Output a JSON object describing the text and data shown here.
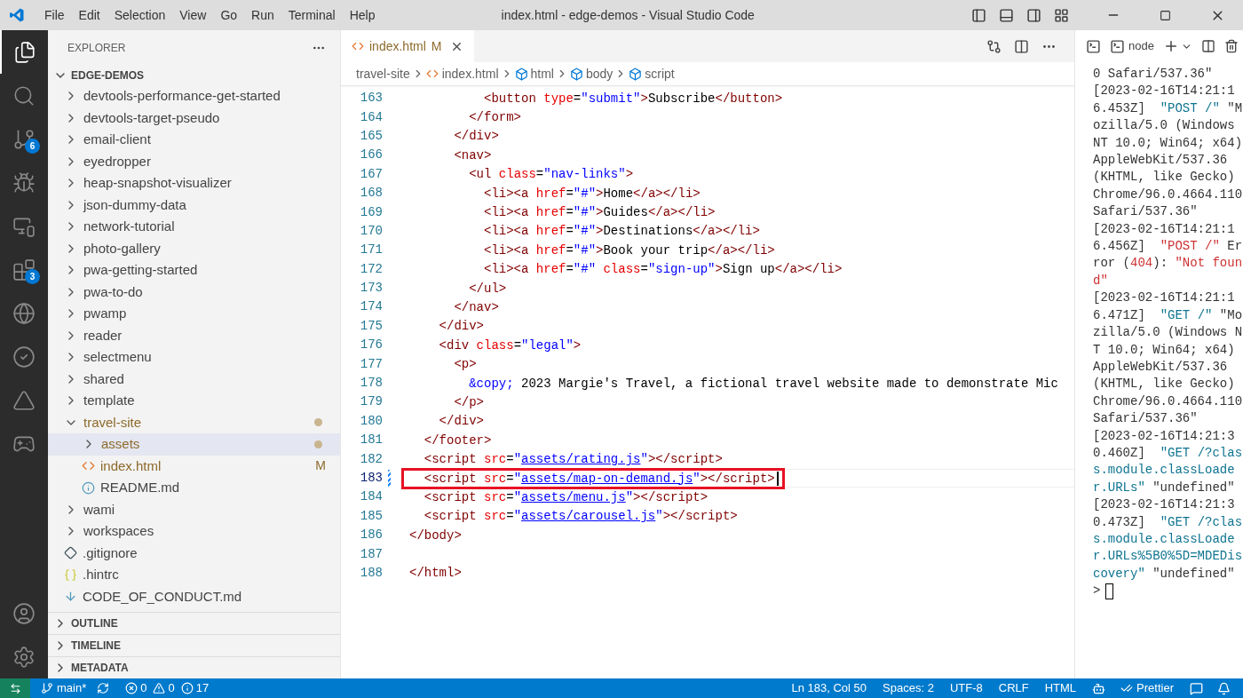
{
  "window": {
    "title": "index.html - edge-demos - Visual Studio Code",
    "menu": [
      "File",
      "Edit",
      "Selection",
      "View",
      "Go",
      "Run",
      "Terminal",
      "Help"
    ]
  },
  "activity_bar": [
    {
      "kind": "explorer",
      "selected": true
    },
    {
      "kind": "search",
      "selected": false
    },
    {
      "kind": "source-control",
      "selected": false,
      "badge": "6"
    },
    {
      "kind": "run",
      "selected": false
    },
    {
      "kind": "remote",
      "selected": false
    },
    {
      "kind": "extensions",
      "selected": false,
      "badge": "3"
    },
    {
      "kind": "edge",
      "selected": false
    },
    {
      "kind": "testing",
      "selected": false
    },
    {
      "kind": "azure",
      "selected": false
    },
    {
      "kind": "gamepad",
      "selected": false
    }
  ],
  "activity_bottom": [
    {
      "kind": "account"
    },
    {
      "kind": "settings"
    }
  ],
  "explorer": {
    "title": "EXPLORER",
    "root": {
      "label": "EDGE-DEMOS",
      "expanded": true,
      "children": [
        {
          "label": "devtools-performance-get-started",
          "kind": "folder",
          "expanded": false,
          "selected": false,
          "modified": false
        },
        {
          "label": "devtools-target-pseudo",
          "kind": "folder",
          "expanded": false,
          "selected": false,
          "modified": false
        },
        {
          "label": "email-client",
          "kind": "folder",
          "expanded": false,
          "selected": false,
          "modified": false
        },
        {
          "label": "eyedropper",
          "kind": "folder",
          "expanded": false,
          "selected": false,
          "modified": false
        },
        {
          "label": "heap-snapshot-visualizer",
          "kind": "folder",
          "expanded": false,
          "selected": false,
          "modified": false
        },
        {
          "label": "json-dummy-data",
          "kind": "folder",
          "expanded": false,
          "selected": false,
          "modified": false
        },
        {
          "label": "network-tutorial",
          "kind": "folder",
          "expanded": false,
          "selected": false,
          "modified": false
        },
        {
          "label": "photo-gallery",
          "kind": "folder",
          "expanded": false,
          "selected": false,
          "modified": false
        },
        {
          "label": "pwa-getting-started",
          "kind": "folder",
          "expanded": false,
          "selected": false,
          "modified": false
        },
        {
          "label": "pwa-to-do",
          "kind": "folder",
          "expanded": false,
          "selected": false,
          "modified": false
        },
        {
          "label": "pwamp",
          "kind": "folder",
          "expanded": false,
          "selected": false,
          "modified": false
        },
        {
          "label": "reader",
          "kind": "folder",
          "expanded": false,
          "selected": false,
          "modified": false
        },
        {
          "label": "selectmenu",
          "kind": "folder",
          "expanded": false,
          "selected": false,
          "modified": false
        },
        {
          "label": "shared",
          "kind": "folder",
          "expanded": false,
          "selected": false,
          "modified": false
        },
        {
          "label": "template",
          "kind": "folder",
          "expanded": false,
          "selected": false,
          "modified": false
        },
        {
          "label": "travel-site",
          "kind": "folder",
          "expanded": true,
          "selected": false,
          "modified": true,
          "children": [
            {
              "label": "assets",
              "kind": "folder",
              "expanded": false,
              "selected": true,
              "modified": true
            },
            {
              "label": "index.html",
              "kind": "html",
              "selected": false,
              "modified": true,
              "badge": "M"
            },
            {
              "label": "README.md",
              "kind": "info",
              "selected": false,
              "modified": false
            }
          ]
        },
        {
          "label": "wami",
          "kind": "folder",
          "expanded": false,
          "selected": false,
          "modified": false
        },
        {
          "label": "workspaces",
          "kind": "folder",
          "expanded": false,
          "selected": false,
          "modified": false
        },
        {
          "label": ".gitignore",
          "kind": "git",
          "selected": false,
          "modified": false
        },
        {
          "label": ".hintrc",
          "kind": "json",
          "selected": false,
          "modified": false
        },
        {
          "label": "CODE_OF_CONDUCT.md",
          "kind": "download",
          "selected": false,
          "modified": false
        }
      ]
    },
    "sections": [
      {
        "label": "OUTLINE",
        "expanded": false
      },
      {
        "label": "TIMELINE",
        "expanded": false
      },
      {
        "label": "METADATA",
        "expanded": false
      }
    ]
  },
  "editor": {
    "tabs": [
      {
        "label": "index.html",
        "badge": "M",
        "selected": true
      }
    ],
    "breadcrumb": [
      {
        "label": "travel-site",
        "kind": "folder"
      },
      {
        "label": "index.html",
        "kind": "html"
      },
      {
        "label": "html",
        "kind": "element"
      },
      {
        "label": "body",
        "kind": "element"
      },
      {
        "label": "script",
        "kind": "element"
      }
    ],
    "lines": [
      {
        "number": "163",
        "current": false,
        "annotated": false,
        "tokens": [
          {
            "kind": "tag",
            "text": "          <button"
          },
          {
            "kind": "attr",
            "text": " type"
          },
          {
            "kind": "text",
            "text": "="
          },
          {
            "kind": "str",
            "text": "\"submit\""
          },
          {
            "kind": "tag",
            "text": ">"
          },
          {
            "kind": "text",
            "text": "Subscribe"
          },
          {
            "kind": "tag",
            "text": "</button>"
          }
        ]
      },
      {
        "number": "164",
        "current": false,
        "annotated": false,
        "tokens": [
          {
            "kind": "tag",
            "text": "        </form>"
          }
        ]
      },
      {
        "number": "165",
        "current": false,
        "annotated": false,
        "tokens": [
          {
            "kind": "tag",
            "text": "      </div>"
          }
        ]
      },
      {
        "number": "166",
        "current": false,
        "annotated": false,
        "tokens": [
          {
            "kind": "tag",
            "text": "      <nav>"
          }
        ]
      },
      {
        "number": "167",
        "current": false,
        "annotated": false,
        "tokens": [
          {
            "kind": "tag",
            "text": "        <ul"
          },
          {
            "kind": "attr",
            "text": " class"
          },
          {
            "kind": "text",
            "text": "="
          },
          {
            "kind": "str",
            "text": "\"nav-links\""
          },
          {
            "kind": "tag",
            "text": ">"
          }
        ]
      },
      {
        "number": "168",
        "current": false,
        "annotated": false,
        "tokens": [
          {
            "kind": "tag",
            "text": "          <li><a"
          },
          {
            "kind": "attr",
            "text": " href"
          },
          {
            "kind": "text",
            "text": "="
          },
          {
            "kind": "str",
            "text": "\"#\""
          },
          {
            "kind": "tag",
            "text": ">"
          },
          {
            "kind": "text",
            "text": "Home"
          },
          {
            "kind": "tag",
            "text": "</a></li>"
          }
        ]
      },
      {
        "number": "169",
        "current": false,
        "annotated": false,
        "tokens": [
          {
            "kind": "tag",
            "text": "          <li><a"
          },
          {
            "kind": "attr",
            "text": " href"
          },
          {
            "kind": "text",
            "text": "="
          },
          {
            "kind": "str",
            "text": "\"#\""
          },
          {
            "kind": "tag",
            "text": ">"
          },
          {
            "kind": "text",
            "text": "Guides"
          },
          {
            "kind": "tag",
            "text": "</a></li>"
          }
        ]
      },
      {
        "number": "170",
        "current": false,
        "annotated": false,
        "tokens": [
          {
            "kind": "tag",
            "text": "          <li><a"
          },
          {
            "kind": "attr",
            "text": " href"
          },
          {
            "kind": "text",
            "text": "="
          },
          {
            "kind": "str",
            "text": "\"#\""
          },
          {
            "kind": "tag",
            "text": ">"
          },
          {
            "kind": "text",
            "text": "Destinations"
          },
          {
            "kind": "tag",
            "text": "</a></li>"
          }
        ]
      },
      {
        "number": "171",
        "current": false,
        "annotated": false,
        "tokens": [
          {
            "kind": "tag",
            "text": "          <li><a"
          },
          {
            "kind": "attr",
            "text": " href"
          },
          {
            "kind": "text",
            "text": "="
          },
          {
            "kind": "str",
            "text": "\"#\""
          },
          {
            "kind": "tag",
            "text": ">"
          },
          {
            "kind": "text",
            "text": "Book your trip"
          },
          {
            "kind": "tag",
            "text": "</a></li>"
          }
        ]
      },
      {
        "number": "172",
        "current": false,
        "annotated": false,
        "tokens": [
          {
            "kind": "tag",
            "text": "          <li><a"
          },
          {
            "kind": "attr",
            "text": " href"
          },
          {
            "kind": "text",
            "text": "="
          },
          {
            "kind": "str",
            "text": "\"#\""
          },
          {
            "kind": "attr",
            "text": " class"
          },
          {
            "kind": "text",
            "text": "="
          },
          {
            "kind": "str",
            "text": "\"sign-up\""
          },
          {
            "kind": "tag",
            "text": ">"
          },
          {
            "kind": "text",
            "text": "Sign up"
          },
          {
            "kind": "tag",
            "text": "</a></li>"
          }
        ]
      },
      {
        "number": "173",
        "current": false,
        "annotated": false,
        "tokens": [
          {
            "kind": "tag",
            "text": "        </ul>"
          }
        ]
      },
      {
        "number": "174",
        "current": false,
        "annotated": false,
        "tokens": [
          {
            "kind": "tag",
            "text": "      </nav>"
          }
        ]
      },
      {
        "number": "175",
        "current": false,
        "annotated": false,
        "tokens": [
          {
            "kind": "tag",
            "text": "    </div>"
          }
        ]
      },
      {
        "number": "176",
        "current": false,
        "annotated": false,
        "tokens": [
          {
            "kind": "tag",
            "text": "    <div"
          },
          {
            "kind": "attr",
            "text": " class"
          },
          {
            "kind": "text",
            "text": "="
          },
          {
            "kind": "str",
            "text": "\"legal\""
          },
          {
            "kind": "tag",
            "text": ">"
          }
        ]
      },
      {
        "number": "177",
        "current": false,
        "annotated": false,
        "tokens": [
          {
            "kind": "tag",
            "text": "      <p>"
          }
        ]
      },
      {
        "number": "178",
        "current": false,
        "annotated": false,
        "tokens": [
          {
            "kind": "entity",
            "text": "        &copy;"
          },
          {
            "kind": "text",
            "text": " 2023 Margie's Travel, a fictional travel website made to demonstrate Mic"
          }
        ]
      },
      {
        "number": "179",
        "current": false,
        "annotated": false,
        "tokens": [
          {
            "kind": "tag",
            "text": "      </p>"
          }
        ]
      },
      {
        "number": "180",
        "current": false,
        "annotated": false,
        "tokens": [
          {
            "kind": "tag",
            "text": "    </div>"
          }
        ]
      },
      {
        "number": "181",
        "current": false,
        "annotated": false,
        "tokens": [
          {
            "kind": "tag",
            "text": "  </footer>"
          }
        ]
      },
      {
        "number": "182",
        "current": false,
        "annotated": false,
        "tokens": [
          {
            "kind": "tag",
            "text": "  <script"
          },
          {
            "kind": "attr",
            "text": " src"
          },
          {
            "kind": "text",
            "text": "="
          },
          {
            "kind": "str",
            "text": "\""
          },
          {
            "kind": "link",
            "text": "assets/rating.js"
          },
          {
            "kind": "str",
            "text": "\""
          },
          {
            "kind": "tag",
            "text": "></script>"
          }
        ]
      },
      {
        "number": "183",
        "current": true,
        "annotated": true,
        "tokens": [
          {
            "kind": "tag",
            "text": "  <script"
          },
          {
            "kind": "attr",
            "text": " src"
          },
          {
            "kind": "text",
            "text": "="
          },
          {
            "kind": "str",
            "text": "\""
          },
          {
            "kind": "link",
            "text": "assets/map-on-demand.js"
          },
          {
            "kind": "str",
            "text": "\""
          },
          {
            "kind": "tag",
            "text": "></script>"
          }
        ]
      },
      {
        "number": "184",
        "current": false,
        "annotated": false,
        "tokens": [
          {
            "kind": "tag",
            "text": "  <script"
          },
          {
            "kind": "attr",
            "text": " src"
          },
          {
            "kind": "text",
            "text": "="
          },
          {
            "kind": "str",
            "text": "\""
          },
          {
            "kind": "link",
            "text": "assets/menu.js"
          },
          {
            "kind": "str",
            "text": "\""
          },
          {
            "kind": "tag",
            "text": "></script>"
          }
        ]
      },
      {
        "number": "185",
        "current": false,
        "annotated": false,
        "tokens": [
          {
            "kind": "tag",
            "text": "  <script"
          },
          {
            "kind": "attr",
            "text": " src"
          },
          {
            "kind": "text",
            "text": "="
          },
          {
            "kind": "str",
            "text": "\""
          },
          {
            "kind": "link",
            "text": "assets/carousel.js"
          },
          {
            "kind": "str",
            "text": "\""
          },
          {
            "kind": "tag",
            "text": "></script>"
          }
        ]
      },
      {
        "number": "186",
        "current": false,
        "annotated": false,
        "tokens": [
          {
            "kind": "tag",
            "text": "</body>"
          }
        ]
      },
      {
        "number": "187",
        "current": false,
        "annotated": false
      },
      {
        "number": "188",
        "current": false,
        "annotated": false,
        "tokens": [
          {
            "kind": "tag",
            "text": "</html>"
          }
        ]
      }
    ]
  },
  "terminal": {
    "tab": "node",
    "entries": [
      {
        "segments": [
          {
            "kind": "plain",
            "text": "0 Safari/537.36\""
          }
        ]
      },
      {
        "segments": [
          {
            "kind": "plain",
            "text": "[2023-02-16T14:21:16.453Z]  "
          },
          {
            "kind": "teal",
            "text": "\"POST /\""
          },
          {
            "kind": "plain",
            "text": " \"Mozilla/5.0 (Windows NT 10.0; Win64; x64) AppleWebKit/537.36 (KHTML, like Gecko) Chrome/96.0.4664.110 Safari/537.36\""
          }
        ]
      },
      {
        "segments": [
          {
            "kind": "plain",
            "text": "[2023-02-16T14:21:16.456Z]  "
          },
          {
            "kind": "red",
            "text": "\"POST /\""
          },
          {
            "kind": "plain",
            "text": " Error ("
          },
          {
            "kind": "red",
            "text": "404"
          },
          {
            "kind": "plain",
            "text": "): "
          },
          {
            "kind": "red",
            "text": "\"Not found\""
          }
        ]
      },
      {
        "segments": [
          {
            "kind": "plain",
            "text": "[2023-02-16T14:21:16.471Z]  "
          },
          {
            "kind": "teal",
            "text": "\"GET /\""
          },
          {
            "kind": "plain",
            "text": " \"Mozilla/5.0 (Windows NT 10.0; Win64; x64) AppleWebKit/537.36 (KHTML, like Gecko) Chrome/96.0.4664.110 Safari/537.36\""
          }
        ]
      },
      {
        "segments": [
          {
            "kind": "plain",
            "text": "[2023-02-16T14:21:30.460Z]  "
          },
          {
            "kind": "teal",
            "text": "\"GET /?class.module.classLoader.URLs\""
          },
          {
            "kind": "plain",
            "text": " \"undefined\""
          }
        ]
      },
      {
        "segments": [
          {
            "kind": "plain",
            "text": "[2023-02-16T14:21:30.473Z]  "
          },
          {
            "kind": "teal",
            "text": "\"GET /?class.module.classLoader.URLs%5B0%5D=MDEDiscovery\""
          },
          {
            "kind": "plain",
            "text": " \"undefined\""
          }
        ]
      }
    ],
    "prompt": ">"
  },
  "status_bar": {
    "branch": "main*",
    "errors": "0",
    "warnings": "0",
    "infos": "17",
    "right": [
      "Ln 183, Col 50",
      "Spaces: 2",
      "UTF-8",
      "CRLF",
      "HTML"
    ],
    "formatter": "Prettier"
  }
}
